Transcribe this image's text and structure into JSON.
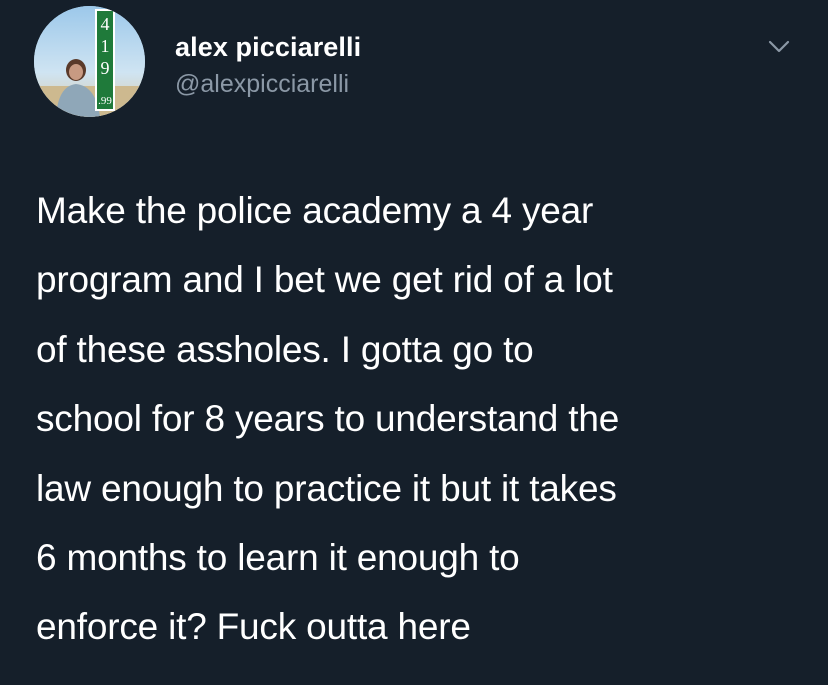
{
  "author": {
    "display_name": "alex picciarelli",
    "handle": "@alexpicciarelli",
    "avatar_sign": [
      "4",
      "1",
      "9",
      ".99"
    ]
  },
  "menu_icon": "chevron-down-icon",
  "tweet": {
    "lines": [
      "Make the police academy a 4 year",
      "program and I bet we get rid of a lot",
      "of these assholes. I gotta go to",
      "school for 8 years to understand the",
      "law enough to practice it but it takes",
      "6 months to learn it enough to",
      "enforce it? Fuck outta here"
    ]
  },
  "colors": {
    "background": "#151f2a",
    "text": "#ffffff",
    "secondary_text": "#8b98a6",
    "sign_green": "#1f7a3a"
  }
}
